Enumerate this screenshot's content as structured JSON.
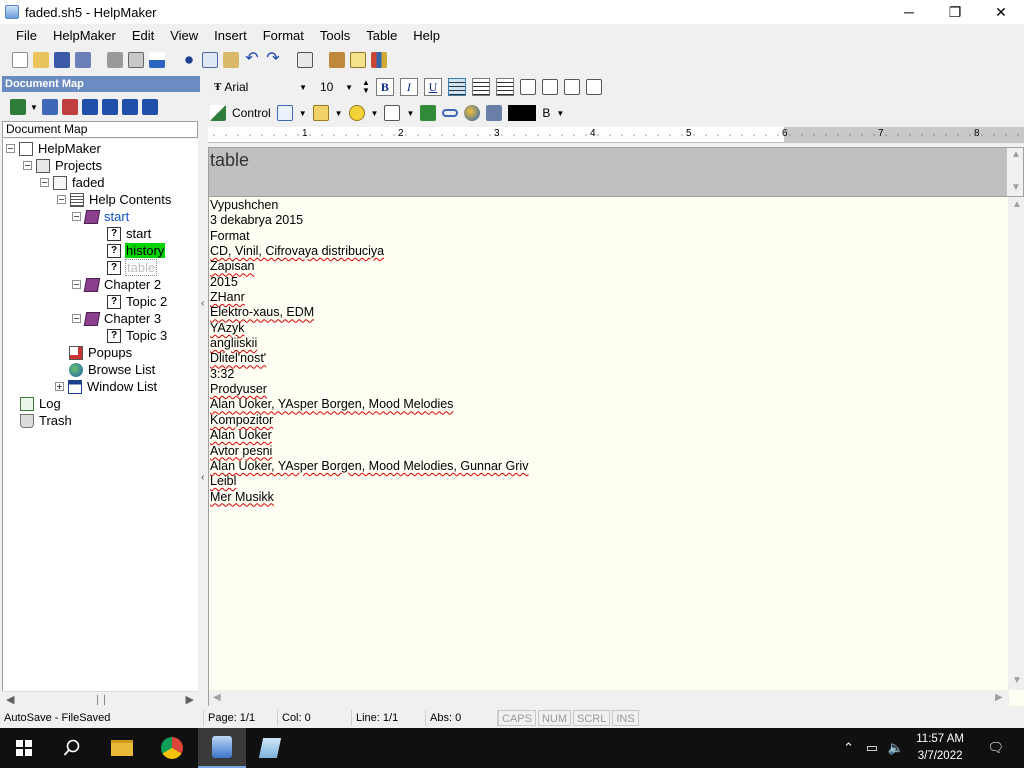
{
  "window": {
    "title": "faded.sh5 - HelpMaker",
    "minimize_glyph": "─",
    "maximize_glyph": "❐",
    "close_glyph": "✕"
  },
  "menu": [
    "File",
    "HelpMaker",
    "Edit",
    "View",
    "Insert",
    "Format",
    "Tools",
    "Table",
    "Help"
  ],
  "font_toolbar": {
    "font_name": "Arial",
    "font_size": "10",
    "bold_label": "B",
    "italic_label": "I",
    "underline_label": "U",
    "control_label": "Control",
    "text_color_label": "B"
  },
  "document_map": {
    "header": "Document Map",
    "label": "Document Map",
    "tree": [
      {
        "label": "HelpMaker",
        "icon": "home-icon",
        "expander": "−",
        "level": 0
      },
      {
        "label": "Projects",
        "icon": "projects-icon",
        "expander": "−",
        "level": 1
      },
      {
        "label": "faded",
        "icon": "project-icon",
        "expander": "−",
        "level": 2
      },
      {
        "label": "Help Contents",
        "icon": "contents-icon",
        "expander": "−",
        "level": 3
      },
      {
        "label": "start",
        "icon": "book-icon",
        "expander": "−",
        "level": 4
      },
      {
        "label": "start",
        "icon": "topic-icon",
        "expander": "",
        "level": 5
      },
      {
        "label": "history",
        "icon": "topic-icon",
        "expander": "",
        "level": 5
      },
      {
        "label": "table",
        "icon": "topic-icon",
        "expander": "",
        "level": 5
      },
      {
        "label": "Chapter 2",
        "icon": "book-icon",
        "expander": "−",
        "level": 4
      },
      {
        "label": "Topic 2",
        "icon": "topic-icon",
        "expander": "",
        "level": 5
      },
      {
        "label": "Chapter 3",
        "icon": "book-icon",
        "expander": "−",
        "level": 4
      },
      {
        "label": "Topic 3",
        "icon": "topic-icon",
        "expander": "",
        "level": 5
      },
      {
        "label": "Popups",
        "icon": "popups-icon",
        "expander": "",
        "level": 3
      },
      {
        "label": "Browse List",
        "icon": "globe-icon",
        "expander": "",
        "level": 3
      },
      {
        "label": "Window List",
        "icon": "window-list-icon",
        "expander": "+",
        "level": 3
      },
      {
        "label": "Log",
        "icon": "log-icon",
        "expander": "",
        "level": 1
      },
      {
        "label": "Trash",
        "icon": "trash-icon",
        "expander": "",
        "level": 1
      }
    ]
  },
  "topic": {
    "title": "table",
    "lines": [
      "Vypushchen",
      "3 dekabrya 2015",
      "Format",
      "CD, Vinil, Cifrovaya distribuciya",
      "Zapisan",
      "2015",
      "ZHanr",
      "Elektro-xaus, EDM",
      "YAzyk",
      "angliiskii",
      "Dlitel'nost'",
      "3:32",
      "Prodyuser",
      "Alan Uoker, YAsper Borgen, Mood Melodies",
      "Kompozitor",
      "Alan Uoker",
      "Avtor pesni",
      "Alan Uoker, YAsper Borgen, Mood Melodies, Gunnar Griv",
      "Leibl",
      "Mer Musikk"
    ]
  },
  "ruler_numbers": [
    "1",
    "2",
    "3",
    "4",
    "5",
    "6",
    "7",
    "8"
  ],
  "status": {
    "autosave": "AutoSave - FileSaved",
    "page": "Page: 1/1",
    "col": "Col: 0",
    "line": "Line: 1/1",
    "abs": "Abs: 0",
    "caps": "CAPS",
    "num": "NUM",
    "scrl": "SCRL",
    "ins": "INS"
  },
  "taskbar": {
    "time": "11:57 AM",
    "date": "3/7/2022"
  },
  "colors": {
    "docmap_header": "#6b8cc2",
    "selected_node": "#00d400",
    "editor_bg": "#fffef3",
    "taskbar": "#101010"
  }
}
